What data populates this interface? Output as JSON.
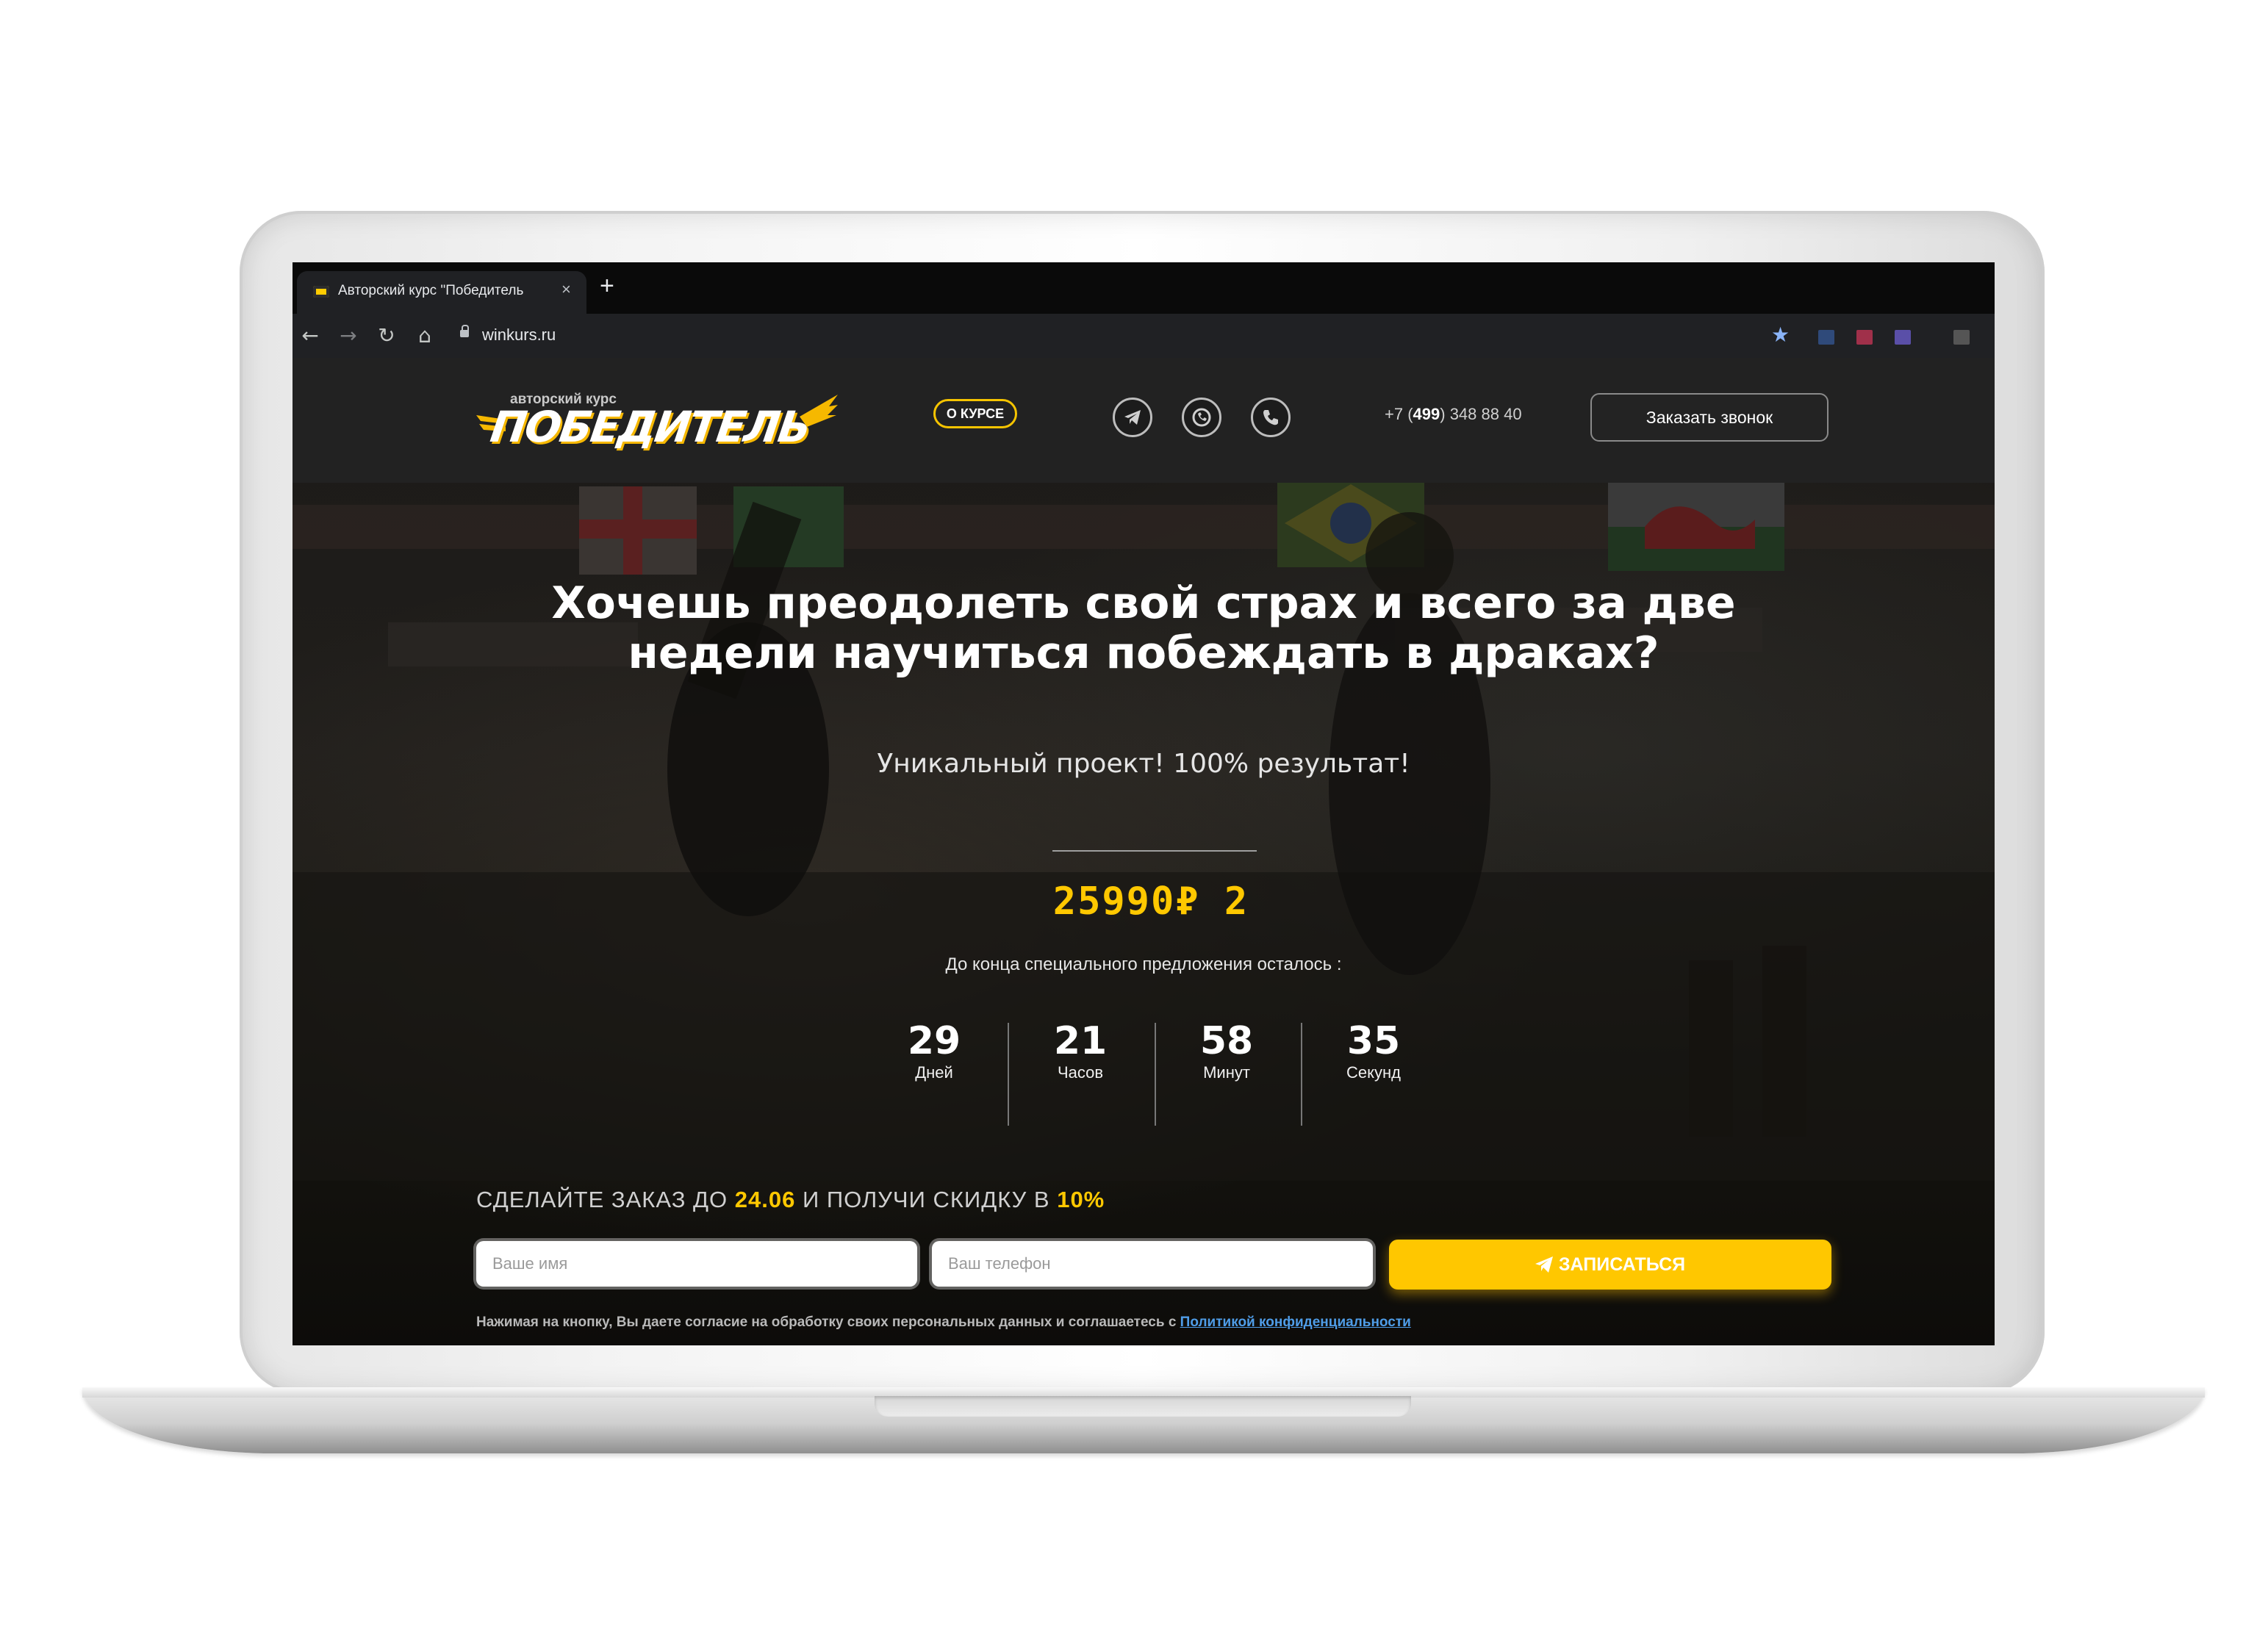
{
  "browser": {
    "tab_title": "Авторский курс \"Победитель",
    "tab_close": "×",
    "new_tab": "+",
    "url": "winkurs.ru",
    "back": "←",
    "forward": "→",
    "reload": "↻",
    "home": "⌂",
    "bookmark": "★"
  },
  "header": {
    "logo_small": "авторский курс",
    "logo_main": "ПОБЕДИТЕЛЬ",
    "nav_about": "О КУРСЕ",
    "social_icons": [
      "telegram-icon",
      "viber-icon",
      "phone-icon"
    ],
    "phone_prefix": "+7 (",
    "phone_code": "499",
    "phone_rest": ") 348 88 40",
    "callback_label": "Заказать звонок"
  },
  "hero": {
    "headline": "Хочешь преодолеть свой страх и всего за две недели научиться побеждать в драках?",
    "subtitle": "Уникальный проект! 100% результат!",
    "price": "25990₽ 2",
    "offer_note": "До конца специального предложения осталось :",
    "countdown": [
      {
        "value": "29",
        "label": "Дней"
      },
      {
        "value": "21",
        "label": "Часов"
      },
      {
        "value": "58",
        "label": "Минут"
      },
      {
        "value": "35",
        "label": "Секунд"
      }
    ]
  },
  "order": {
    "promo_part1": "СДЕЛАЙТЕ ЗАКАЗ ДО ",
    "promo_date": "24.06",
    "promo_part2": " И ПОЛУЧИ СКИДКУ В ",
    "promo_discount": "10%",
    "name_placeholder": "Ваше имя",
    "phone_placeholder": "Ваш телефон",
    "submit_label": "ЗАПИСАТЬСЯ",
    "consent_text": "Нажимая на кнопку, Вы даете согласие на обработку своих персональных данных и соглашаетесь с ",
    "consent_link": "Политикой конфиденциальности"
  },
  "colors": {
    "accent": "#ffc700",
    "header_bg": "#222222",
    "link": "#4f9de8"
  }
}
